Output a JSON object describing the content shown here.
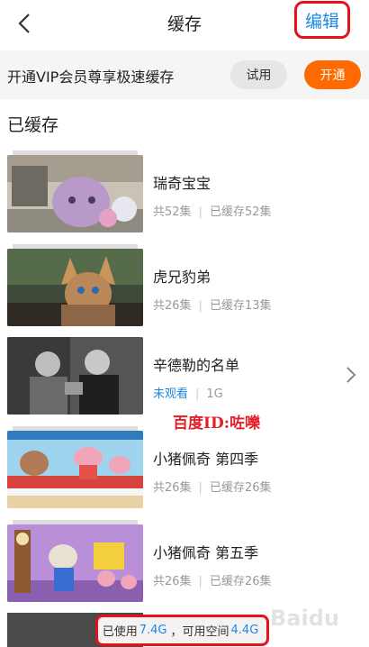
{
  "header": {
    "title": "缓存",
    "edit_label": "编辑"
  },
  "vip_banner": {
    "text": "开通VIP会员尊享极速缓存",
    "try_label": "试用",
    "open_label": "开通"
  },
  "section_title": "已缓存",
  "items": [
    {
      "name": "瑞奇宝宝",
      "total": "共52集",
      "cached": "已缓存52集"
    },
    {
      "name": "虎兄豹弟",
      "total": "共26集",
      "cached": "已缓存13集"
    },
    {
      "name": "辛德勒的名单",
      "status": "未观看",
      "size": "1G"
    },
    {
      "name": "小猪佩奇 第四季",
      "total": "共26集",
      "cached": "已缓存26集"
    },
    {
      "name": "小猪佩奇 第五季",
      "total": "共26集",
      "cached": "已缓存26集"
    }
  ],
  "watermark": "百度ID:咗嚛",
  "storage": {
    "used_label": "已使用",
    "used_value": "7.4G",
    "free_label": "，可用空间",
    "free_value": "4.4G"
  },
  "bg_watermark": "Baidu",
  "colors": {
    "accent_blue": "#1e88e5",
    "accent_orange": "#ff6a00",
    "highlight_red": "#e5121a"
  }
}
